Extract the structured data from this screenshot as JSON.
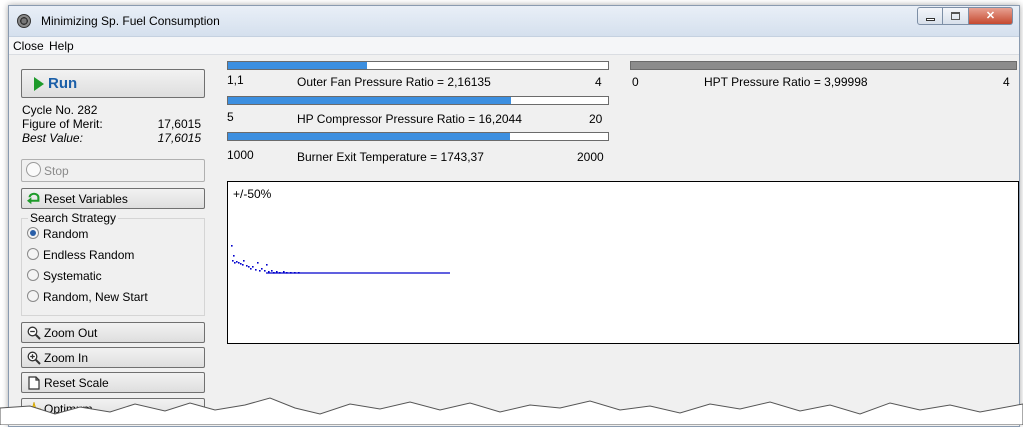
{
  "window": {
    "title": "Minimizing Sp. Fuel Consumption"
  },
  "menu": [
    "Close",
    "Help"
  ],
  "sidebar": {
    "run_label": "Run",
    "cycle": "Cycle No. 282",
    "figure_label": "Figure of Merit:",
    "figure_value": "17,6015",
    "best_label": "Best Value:",
    "best_value": "17,6015",
    "stop_label": "Stop",
    "reset_vars_label": "Reset Variables",
    "search_title": "Search Strategy",
    "strategies": [
      {
        "label": "Random",
        "selected": true
      },
      {
        "label": "Endless Random",
        "selected": false
      },
      {
        "label": "Systematic",
        "selected": false
      },
      {
        "label": "Random, New Start",
        "selected": false
      }
    ],
    "zoom_out_label": "Zoom Out",
    "zoom_in_label": "Zoom In",
    "reset_scale_label": "Reset Scale",
    "optimum_label": "Optimum"
  },
  "sliders": [
    {
      "min": "1,1",
      "max": "4",
      "label": "Outer Fan Pressure Ratio = 2,16135",
      "fraction": 0.365,
      "color": "#3c8fe0"
    },
    {
      "min": "5",
      "max": "20",
      "label": "HP Compressor Pressure Ratio = 16,2044",
      "fraction": 0.745,
      "color": "#3c8fe0"
    },
    {
      "min": "1000",
      "max": "2000",
      "label": "Burner Exit Temperature = 1743,37",
      "fraction": 0.743,
      "color": "#3c8fe0"
    },
    {
      "min": "0",
      "max": "4",
      "label": "HPT Pressure Ratio = 3,99998",
      "fraction": 1.0,
      "color": "#8c8c8c"
    }
  ],
  "plot": {
    "scale_label": "+/-50%",
    "line_color": "#0000cc"
  },
  "icons": {
    "run": "play-triangle-icon",
    "stop": "circle-icon",
    "reset_variables": "green-refresh-arrow-icon",
    "zoom_out": "magnifier-minus-icon",
    "zoom_in": "magnifier-plus-icon",
    "reset_scale": "page-icon",
    "optimum": "sparkle-icon"
  }
}
